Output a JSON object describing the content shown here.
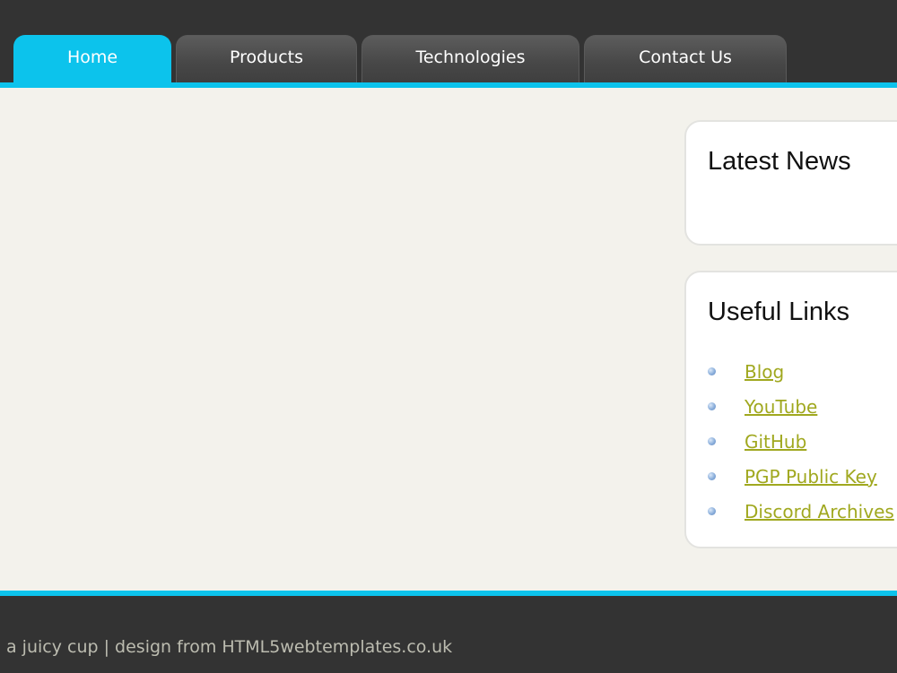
{
  "nav": {
    "tabs": [
      {
        "label": "Home",
        "active": true
      },
      {
        "label": "Products",
        "active": false
      },
      {
        "label": "Technologies",
        "active": false
      },
      {
        "label": "Contact Us",
        "active": false
      }
    ]
  },
  "sidebar": {
    "latest_news": {
      "title": "Latest News"
    },
    "useful_links": {
      "title": "Useful Links",
      "links": [
        "Blog",
        "YouTube",
        "GitHub",
        "PGP Public Key",
        "Discord Archives"
      ]
    }
  },
  "footer": {
    "text": "a juicy cup | design from HTML5webtemplates.co.uk"
  },
  "colors": {
    "accent": "#0cc3ec",
    "header_bg": "#333333",
    "content_bg": "#f3f2ec",
    "link": "#a0a81f"
  },
  "icons": {
    "list_bullet": "blue-dot-bullet-icon"
  }
}
